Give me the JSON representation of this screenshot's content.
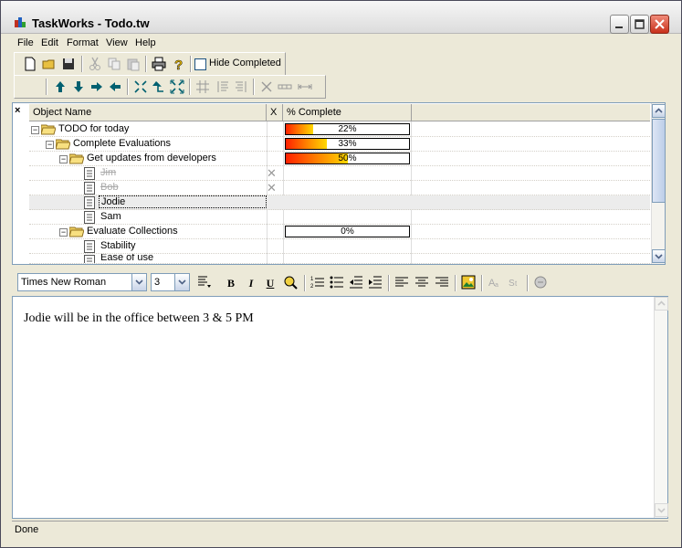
{
  "window": {
    "title": "TaskWorks - Todo.tw"
  },
  "menu": [
    "File",
    "Edit",
    "Format",
    "View",
    "Help"
  ],
  "toolbar": {
    "hide_completed_label": "Hide Completed"
  },
  "tree": {
    "columns": [
      "Object Name",
      "X",
      "% Complete"
    ],
    "rows": [
      {
        "label": "TODO for today",
        "progress": 22,
        "progress_text": "22%"
      },
      {
        "label": "Complete Evaluations",
        "progress": 33,
        "progress_text": "33%"
      },
      {
        "label": "Get updates from developers",
        "progress": 50,
        "progress_text": "50%"
      },
      {
        "label": "Jim",
        "completed": true
      },
      {
        "label": "Bob",
        "completed": true
      },
      {
        "label": "Jodie",
        "selected": true
      },
      {
        "label": "Sam"
      },
      {
        "label": "Evaluate Collections",
        "progress": 0,
        "progress_text": "0%"
      },
      {
        "label": "Stability"
      },
      {
        "label": "Ease of use"
      }
    ]
  },
  "format": {
    "font_name": "Times New Roman",
    "font_size": "3"
  },
  "editor": {
    "text": "Jodie will be in the office between 3 & 5 PM"
  },
  "status": {
    "text": "Done"
  }
}
